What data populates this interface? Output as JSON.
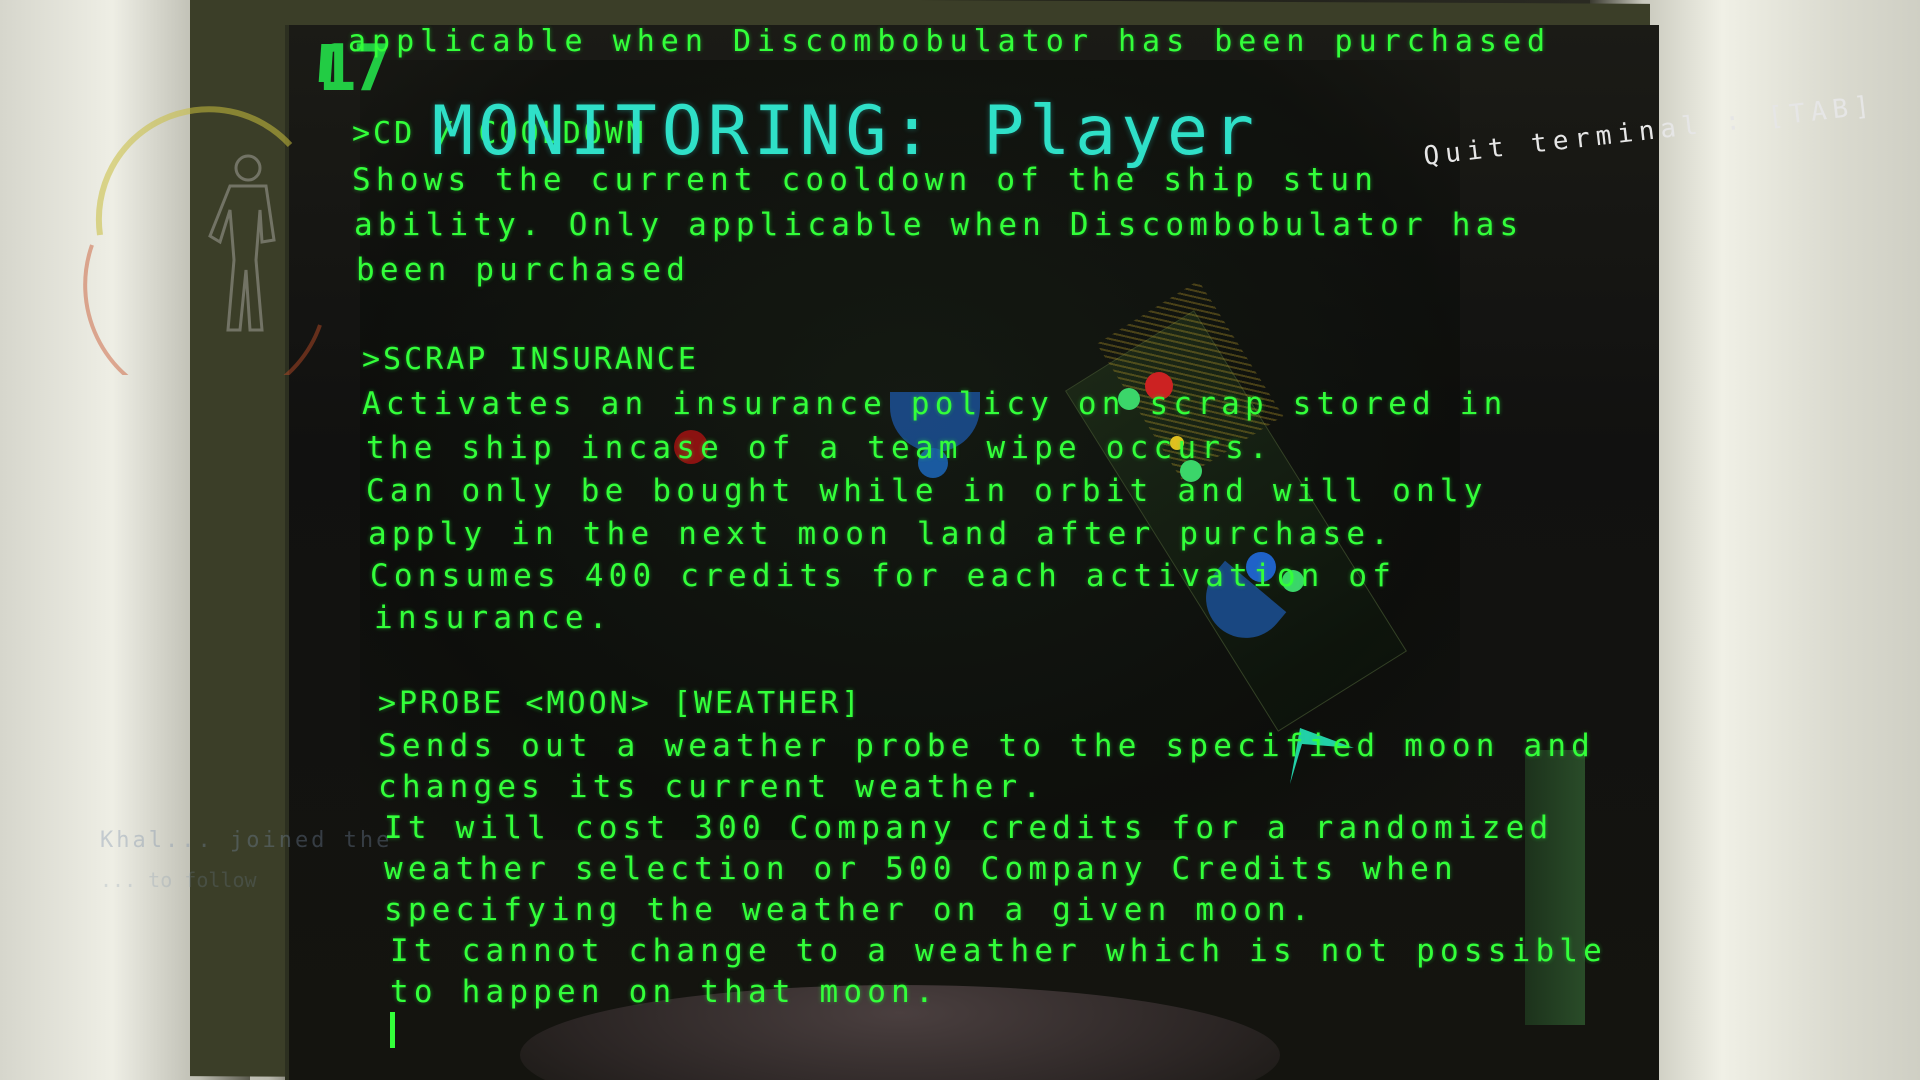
{
  "hud": {
    "player_count": "17",
    "chat_line": "Khal... joined the",
    "chat_faint": "... to follow"
  },
  "monitor": {
    "title": "MONITORING: Player",
    "quit_hint": "Quit terminal : [TAB]"
  },
  "terminal": {
    "line_top": "applicable when Discombobulator has been purchased",
    "cooldown_header": ">CD / COOLDOWN",
    "cooldown_desc": [
      "Shows the current cooldown of the ship stun",
      "ability. Only applicable when Discombobulator has",
      "been purchased"
    ],
    "insurance_header": ">SCRAP INSURANCE",
    "insurance_desc": [
      "Activates an insurance policy on scrap stored in",
      "the ship incase of a team wipe occurs.",
      "Can only be bought while in orbit and will only",
      "apply in the next moon land after purchase.",
      "Consumes 400 credits for each activation of",
      "insurance."
    ],
    "probe_header": ">PROBE <MOON> [WEATHER]",
    "probe_desc": [
      "Sends out a weather probe to the specified moon and",
      "changes its current weather.",
      "It will cost 300 Company credits for a randomized",
      "weather selection or 500 Company Credits when",
      "specifying the weather on a given moon.",
      "It cannot change to a weather which is not possible",
      "to happen on that moon."
    ]
  },
  "colors": {
    "terminal_text": "#33ff3a",
    "monitor_title": "#2fe0c8",
    "hud_green": "#22cc44"
  }
}
